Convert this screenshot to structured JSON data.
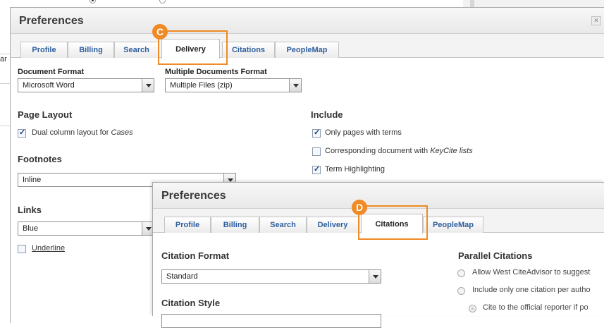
{
  "background_window": {
    "cut_text": "ar"
  },
  "back_dialog": {
    "title": "Preferences",
    "close_icon": "close-icon",
    "tabs": [
      {
        "label": "Profile",
        "active": false
      },
      {
        "label": "Billing",
        "active": false
      },
      {
        "label": "Search",
        "active": false
      },
      {
        "label": "Delivery",
        "active": true
      },
      {
        "label": "Citations",
        "active": false
      },
      {
        "label": "PeopleMap",
        "active": false
      }
    ],
    "marker": "C",
    "document_format": {
      "label": "Document Format",
      "value": "Microsoft Word"
    },
    "multiple_documents_format": {
      "label": "Multiple Documents Format",
      "value": "Multiple Files (zip)"
    },
    "page_layout": {
      "heading": "Page Layout",
      "option_prefix": "Dual column layout for ",
      "option_italic": "Cases",
      "checked": true
    },
    "include": {
      "heading": "Include",
      "options": [
        {
          "label": "Only pages with terms",
          "checked": true
        },
        {
          "label_prefix": "Corresponding document with ",
          "label_italic": "KeyCite lists",
          "checked": false
        },
        {
          "label": "Term Highlighting",
          "checked": true
        }
      ]
    },
    "footnotes": {
      "heading": "Footnotes",
      "value": "Inline"
    },
    "links": {
      "heading": "Links",
      "value": "Blue",
      "underline_label": "Underline",
      "underline_checked": false
    }
  },
  "front_dialog": {
    "title": "Preferences",
    "tabs": [
      {
        "label": "Profile",
        "active": false
      },
      {
        "label": "Billing",
        "active": false
      },
      {
        "label": "Search",
        "active": false
      },
      {
        "label": "Delivery",
        "active": false
      },
      {
        "label": "Citations",
        "active": true
      },
      {
        "label": "PeopleMap",
        "active": false
      }
    ],
    "marker": "D",
    "citation_format": {
      "heading": "Citation Format",
      "value": "Standard"
    },
    "citation_style": {
      "heading": "Citation Style"
    },
    "parallel_citations": {
      "heading": "Parallel Citations",
      "options": [
        "Allow West CiteAdvisor to suggest",
        "Include only one citation per autho",
        "Cite to the official reporter if po"
      ]
    }
  },
  "colors": {
    "accent_orange": "#f08a24",
    "tab_link_blue": "#2f5f9e"
  }
}
